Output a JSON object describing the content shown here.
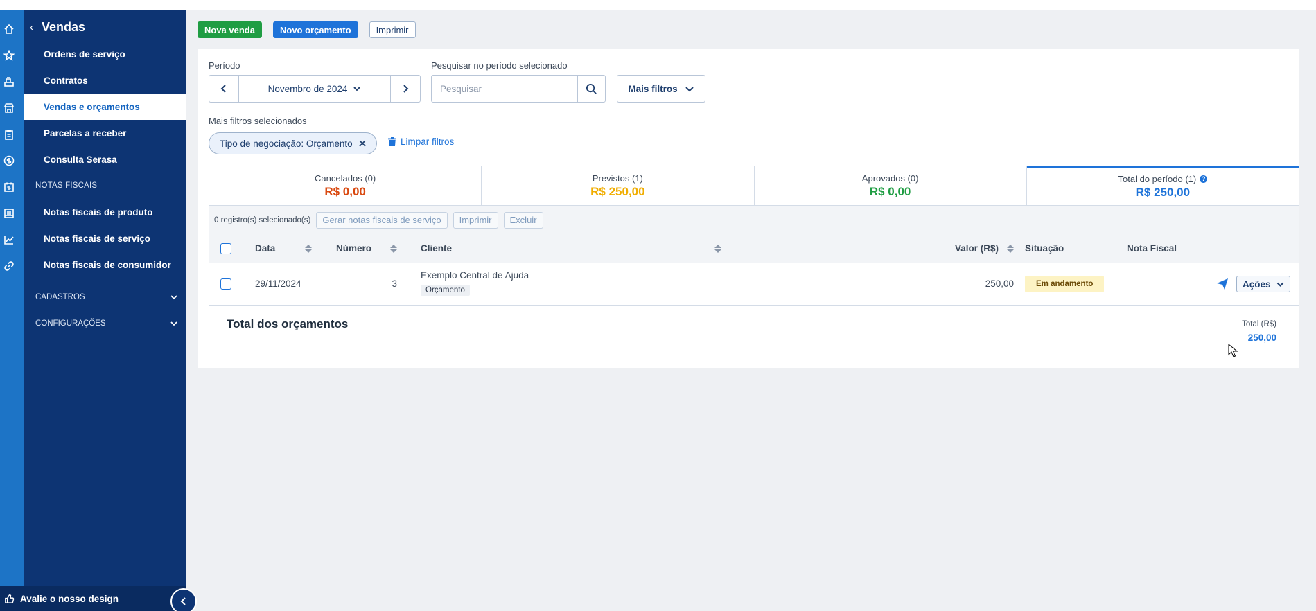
{
  "toolbar": {
    "new_sale": "Nova venda",
    "new_quote": "Novo orçamento",
    "print": "Imprimir"
  },
  "sidebar": {
    "back_title": "Vendas",
    "items": [
      {
        "label": "Ordens de serviço"
      },
      {
        "label": "Contratos"
      },
      {
        "label": "Vendas e orçamentos",
        "active": true
      },
      {
        "label": "Parcelas a receber"
      },
      {
        "label": "Consulta Serasa"
      }
    ],
    "section_fiscal": "NOTAS FISCAIS",
    "fiscal_items": [
      {
        "label": "Notas fiscais de produto"
      },
      {
        "label": "Notas fiscais de serviço"
      },
      {
        "label": "Notas fiscais de consumidor"
      }
    ],
    "groups": [
      {
        "label": "CADASTROS"
      },
      {
        "label": "CONFIGURAÇÕES"
      }
    ],
    "feedback": "Avalie o nosso design"
  },
  "rail_icons": [
    "home-icon",
    "star-icon",
    "cash-register-icon",
    "store-icon",
    "clipboard-icon",
    "dollar-icon",
    "calendar-money-icon",
    "invoice-icon",
    "chart-icon",
    "link-icon"
  ],
  "filters": {
    "period_label": "Período",
    "period_value": "Novembro de 2024",
    "search_label": "Pesquisar no período selecionado",
    "search_placeholder": "Pesquisar",
    "search_value": "",
    "more_filters": "Mais filtros",
    "selected_label": "Mais filtros selecionados",
    "chip": "Tipo de negociação: Orçamento",
    "clear": "Limpar filtros"
  },
  "summary": [
    {
      "label": "Cancelados (0)",
      "value": "R$ 0,00",
      "color": "#d9480f"
    },
    {
      "label": "Previstos (1)",
      "value": "R$ 250,00",
      "color": "#f0ad00"
    },
    {
      "label": "Aprovados (0)",
      "value": "R$ 0,00",
      "color": "#1f9d43"
    },
    {
      "label": "Total do período (1)",
      "value": "R$ 250,00",
      "color": "#1e73d9"
    }
  ],
  "bulk": {
    "count": "0 registro(s) selecionado(s)",
    "gen_invoices": "Gerar notas fiscais de serviço",
    "print": "Imprimir",
    "delete": "Excluir"
  },
  "table": {
    "headers": {
      "date": "Data",
      "number": "Número",
      "client": "Cliente",
      "value": "Valor (R$)",
      "status": "Situação",
      "invoice": "Nota Fiscal"
    },
    "rows": [
      {
        "date": "29/11/2024",
        "number": "3",
        "client": "Exemplo Central de Ajuda",
        "tag": "Orçamento",
        "value": "250,00",
        "status": "Em andamento",
        "actions": "Ações"
      }
    ]
  },
  "totals": {
    "title": "Total dos orçamentos",
    "label": "Total (R$)",
    "value": "250,00"
  }
}
